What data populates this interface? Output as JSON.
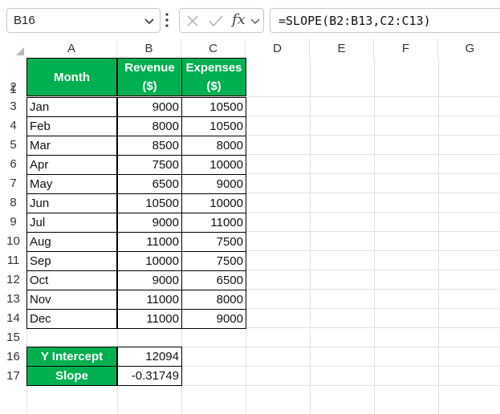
{
  "name_box": {
    "value": "B16"
  },
  "formula_bar": {
    "fx_label": "fx",
    "formula": "=SLOPE(B2:B13,C2:C13)"
  },
  "columns": [
    "A",
    "B",
    "C",
    "D",
    "E",
    "F",
    "G"
  ],
  "rows": [
    "1",
    "2",
    "3",
    "4",
    "5",
    "6",
    "7",
    "8",
    "9",
    "10",
    "11",
    "12",
    "13",
    "14",
    "15",
    "16",
    "17"
  ],
  "table": {
    "headers": {
      "month": "Month",
      "revenue_line1": "Revenue",
      "revenue_line2": "($)",
      "expenses_line1": "Expenses",
      "expenses_line2": "($)"
    },
    "data": [
      {
        "month": "Jan",
        "revenue": "9000",
        "expenses": "10500"
      },
      {
        "month": "Feb",
        "revenue": "8000",
        "expenses": "10500"
      },
      {
        "month": "Mar",
        "revenue": "8500",
        "expenses": "8000"
      },
      {
        "month": "Apr",
        "revenue": "7500",
        "expenses": "10000"
      },
      {
        "month": "May",
        "revenue": "6500",
        "expenses": "9000"
      },
      {
        "month": "Jun",
        "revenue": "10500",
        "expenses": "10000"
      },
      {
        "month": "Jul",
        "revenue": "9000",
        "expenses": "11000"
      },
      {
        "month": "Aug",
        "revenue": "11000",
        "expenses": "7500"
      },
      {
        "month": "Sep",
        "revenue": "10000",
        "expenses": "7500"
      },
      {
        "month": "Oct",
        "revenue": "9000",
        "expenses": "6500"
      },
      {
        "month": "Nov",
        "revenue": "11000",
        "expenses": "8000"
      },
      {
        "month": "Dec",
        "revenue": "11000",
        "expenses": "9000"
      }
    ]
  },
  "results": {
    "intercept_label": "Y Intercept",
    "intercept_value": "12094",
    "slope_label": "Slope",
    "slope_value": "-0.31749"
  },
  "colors": {
    "header_green": "#00b050",
    "gridline": "#e1e1e1"
  }
}
